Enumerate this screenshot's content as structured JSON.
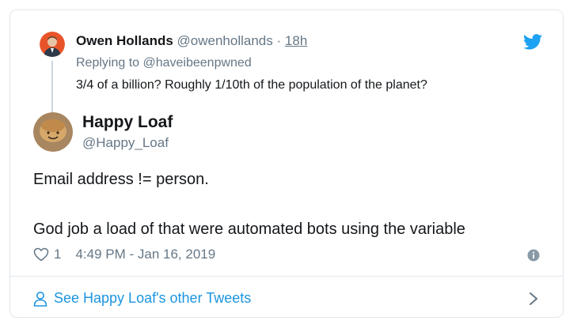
{
  "reply_tweet": {
    "name": "Owen Hollands",
    "handle": "@owenhollands",
    "separator": "·",
    "time": "18h",
    "replying_to": "Replying to @haveibeenpwned",
    "text": "3/4 of a billion?  Roughly 1/10th of the population of the planet?"
  },
  "main_tweet": {
    "name": "Happy Loaf",
    "handle": "@Happy_Loaf",
    "line1": "Email address != person.",
    "line2": "God job a load of that were automated bots using the variable",
    "like_count": "1",
    "timestamp": "4:49 PM - Jan 16, 2019"
  },
  "footer": {
    "link_label": "See Happy Loaf's other Tweets"
  },
  "icons": {
    "brand": "twitter-bird-icon",
    "like": "heart-icon",
    "info": "info-icon",
    "person": "person-icon",
    "chevron": "chevron-right-icon"
  },
  "colors": {
    "twitter_blue": "#1da1f2",
    "link_blue": "#1b95e0",
    "secondary_text": "#657786",
    "primary_text": "#14171a",
    "border": "#e1e8ed"
  }
}
